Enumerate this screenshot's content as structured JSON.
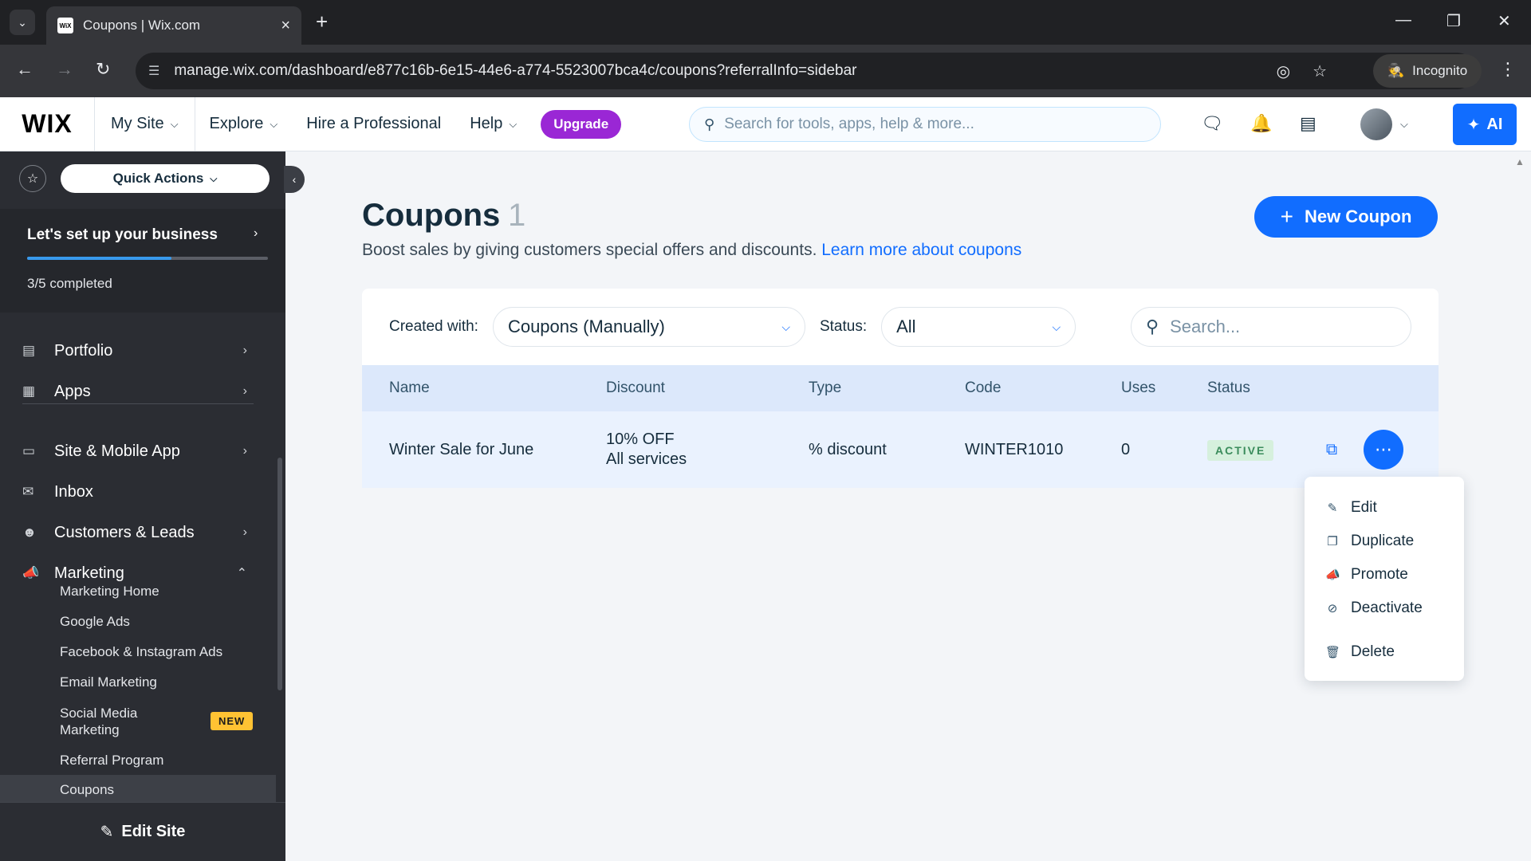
{
  "browser": {
    "tab_title": "Coupons | Wix.com",
    "favicon_text": "WiX",
    "url": "manage.wix.com/dashboard/e877c16b-6e15-44e6-a774-5523007bca4c/coupons?referralInfo=sidebar",
    "incognito_label": "Incognito"
  },
  "topbar": {
    "logo": "WIX",
    "my_site": "My Site",
    "explore": "Explore",
    "hire": "Hire a Professional",
    "help": "Help",
    "upgrade": "Upgrade",
    "search_placeholder": "Search for tools, apps, help & more...",
    "ai_label": "AI"
  },
  "sidebar": {
    "quick_actions": "Quick Actions",
    "setup_title": "Let's set up your business",
    "setup_progress": "3/5 completed",
    "setup_fraction": 0.6,
    "items": [
      {
        "label": "Portfolio",
        "icon": "portfolio-icon"
      },
      {
        "label": "Apps",
        "icon": "apps-icon"
      },
      {
        "label": "Site & Mobile App",
        "icon": "site-mobile-icon"
      },
      {
        "label": "Inbox",
        "icon": "inbox-icon"
      },
      {
        "label": "Customers & Leads",
        "icon": "customers-icon"
      },
      {
        "label": "Marketing",
        "icon": "marketing-icon"
      }
    ],
    "marketing_sub": [
      "Marketing Home",
      "Google Ads",
      "Facebook & Instagram Ads",
      "Email Marketing",
      "Social Media Marketing",
      "Referral Program",
      "Coupons"
    ],
    "new_badge": "NEW",
    "edit_site": "Edit Site"
  },
  "main": {
    "title": "Coupons",
    "count": "1",
    "subtitle": "Boost sales by giving customers special offers and discounts.",
    "learn_more": "Learn more about coupons",
    "new_coupon": "New Coupon",
    "filters": {
      "created_with_label": "Created with:",
      "created_with_value": "Coupons (Manually)",
      "status_label": "Status:",
      "status_value": "All",
      "search_placeholder": "Search..."
    },
    "columns": [
      "Name",
      "Discount",
      "Type",
      "Code",
      "Uses",
      "Status"
    ],
    "rows": [
      {
        "name": "Winter Sale for June",
        "discount_line1": "10% OFF",
        "discount_line2": "All services",
        "type": "% discount",
        "code": "WINTER1010",
        "uses": "0",
        "status": "ACTIVE"
      }
    ]
  },
  "menu": {
    "items": [
      "Edit",
      "Duplicate",
      "Promote",
      "Deactivate",
      "Delete"
    ]
  },
  "colors": {
    "accent": "#116dff",
    "upgrade": "#9a27d5",
    "sidebar_bg": "#2b2d33",
    "active_badge_bg": "#d6f0dd"
  }
}
